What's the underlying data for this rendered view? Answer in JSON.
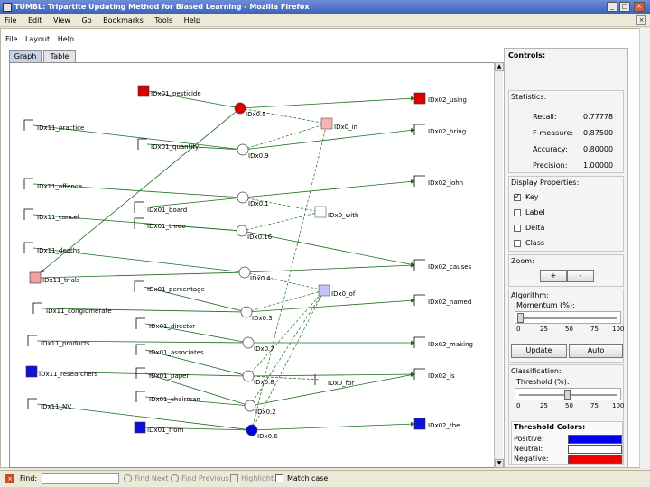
{
  "window": {
    "title": "TUMBL: Tripartite Updating Method for Biased Learning - Mozilla Firefox",
    "buttons": [
      "_",
      "□",
      "×"
    ]
  },
  "browser_menu": [
    "File",
    "Edit",
    "View",
    "Go",
    "Bookmarks",
    "Tools",
    "Help"
  ],
  "app_menu": [
    "File",
    "Layout",
    "Help"
  ],
  "tabs": [
    "Graph",
    "Table"
  ],
  "graph": {
    "docs": [
      {
        "label": "IDx01_pesticide",
        "color": "#dd0000"
      },
      {
        "label": "IDx11_practice",
        "color": "#ffffff"
      },
      {
        "label": "IDx01_quantity",
        "color": "#ffffff"
      },
      {
        "label": "IDx11_offence",
        "color": "#ffffff"
      },
      {
        "label": "IDx01_board",
        "color": "#ffffff"
      },
      {
        "label": "IDx11_cancel",
        "color": "#ffffff"
      },
      {
        "label": "IDx01_three",
        "color": "#ffffff"
      },
      {
        "label": "IDx11_deaths",
        "color": "#ffffff"
      },
      {
        "label": "IDx11_trials",
        "color": "#f0a0a0"
      },
      {
        "label": "IDx01_percentage",
        "color": "#ffffff"
      },
      {
        "label": "IDx11_conglomerate",
        "color": "#ffffff"
      },
      {
        "label": "IDx01_director",
        "color": "#ffffff"
      },
      {
        "label": "IDx11_products",
        "color": "#ffffff"
      },
      {
        "label": "IDx01_associates",
        "color": "#ffffff"
      },
      {
        "label": "IDx11_researchers",
        "color": "#1010dd"
      },
      {
        "label": "IDx01_paper",
        "color": "#ffffff"
      },
      {
        "label": "IDx01_chairman",
        "color": "#ffffff"
      },
      {
        "label": "IDx11_NV",
        "color": "#ffffff"
      },
      {
        "label": "IDx01_from",
        "color": "#1010dd"
      }
    ],
    "features": [
      {
        "label": "IDx0.5"
      },
      {
        "label": "IDx0.9"
      },
      {
        "label": "IDx0.1"
      },
      {
        "label": "IDx0.16"
      },
      {
        "label": "IDx0.4"
      },
      {
        "label": "IDx0.3"
      },
      {
        "label": "IDx0.7"
      },
      {
        "label": "IDx0.8"
      },
      {
        "label": "IDx0.2"
      },
      {
        "label": "IDx0.6"
      }
    ],
    "mids": [
      {
        "label": "IDx0_in"
      },
      {
        "label": "IDx0_with"
      },
      {
        "label": "IDx0_of"
      },
      {
        "label": "IDx0_for"
      }
    ],
    "classes": [
      {
        "label": "IDx02_using"
      },
      {
        "label": "IDx02_bring"
      },
      {
        "label": "IDx02_john"
      },
      {
        "label": "IDx02_causes"
      },
      {
        "label": "IDx02_named"
      },
      {
        "label": "IDx02_making"
      },
      {
        "label": "IDx02_is"
      },
      {
        "label": "IDx02_the"
      }
    ]
  },
  "controls": {
    "title": "Controls:",
    "statistics_title": "Statistics:",
    "stats": [
      {
        "label": "Recall:",
        "value": "0.77778"
      },
      {
        "label": "F-measure:",
        "value": "0.87500"
      },
      {
        "label": "Accuracy:",
        "value": "0.80000"
      },
      {
        "label": "Precision:",
        "value": "1.00000"
      }
    ],
    "display_title": "Display Properties:",
    "display_options": [
      {
        "label": "Key",
        "checked": true
      },
      {
        "label": "Label",
        "checked": false
      },
      {
        "label": "Delta",
        "checked": false
      },
      {
        "label": "Class",
        "checked": false
      }
    ],
    "zoom_title": "Zoom:",
    "zoom_in": "+",
    "zoom_out": "-",
    "algorithm_title": "Algorithm:",
    "momentum_label": "Momentum (%):",
    "momentum_value": 0,
    "slider_ticks": [
      "0",
      "25",
      "50",
      "75",
      "100"
    ],
    "update_label": "Update",
    "auto_label": "Auto",
    "classification_title": "Classification:",
    "threshold_label": "Threshold (%):",
    "threshold_value": 50,
    "threshold_colors_title": "Threshold Colors:",
    "threshold_colors": [
      {
        "label": "Positive:",
        "color": "#0000ee"
      },
      {
        "label": "Neutral:",
        "color": "#ffffff"
      },
      {
        "label": "Negative:",
        "color": "#ee0000"
      }
    ]
  },
  "findbar": {
    "find_label": "Find:",
    "find_value": "",
    "next_label": "Find Next",
    "prev_label": "Find Previous",
    "highlight_label": "Highlight",
    "matchcase_label": "Match case"
  }
}
